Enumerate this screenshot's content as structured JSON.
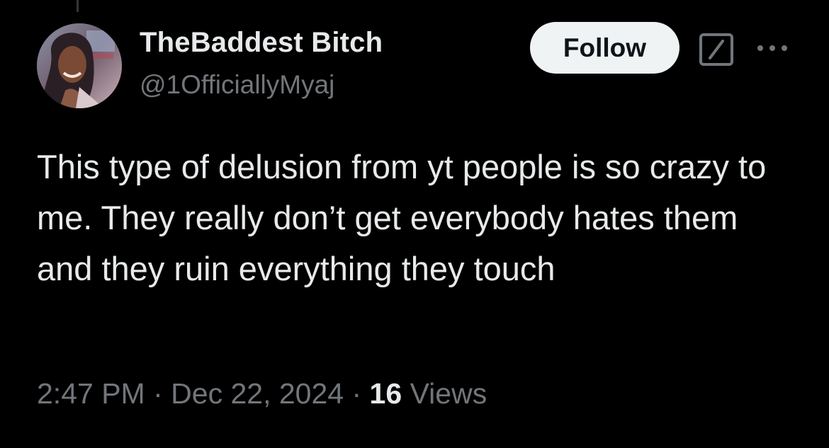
{
  "author": {
    "display_name": "TheBaddest Bitch",
    "handle": "@1OfficiallyMyaj",
    "avatar": "profile-photo"
  },
  "actions": {
    "follow_label": "Follow",
    "grok_icon": "grok-icon",
    "more_icon": "more-horizontal-icon"
  },
  "tweet": {
    "text": "This type of delusion from yt people is so crazy to me. They really don’t get everybody hates them and they ruin everything they touch"
  },
  "meta": {
    "time": "2:47 PM",
    "separator": "·",
    "date": "Dec 22, 2024",
    "views_count": "16",
    "views_label": "Views"
  },
  "colors": {
    "background": "#000000",
    "primary_text": "#e7e9ea",
    "secondary_text": "#71767b",
    "follow_button_bg": "#eff3f4",
    "follow_button_text": "#0f1419"
  }
}
